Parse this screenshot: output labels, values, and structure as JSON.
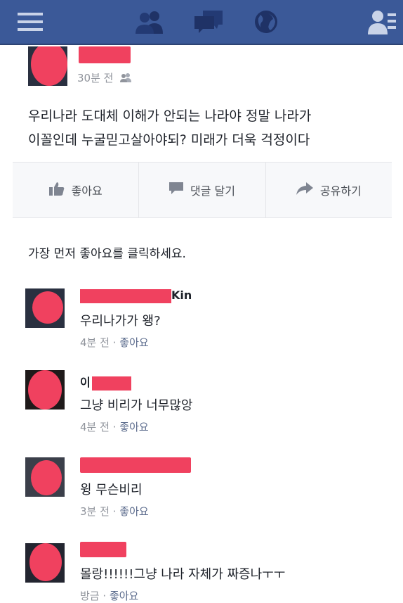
{
  "nav": {
    "icons": [
      "menu-icon",
      "friends-icon",
      "messages-icon",
      "globe-icon",
      "profile-list-icon"
    ]
  },
  "post": {
    "time": "30분 전",
    "audience_icon": "friends-icon",
    "text_line1": "우리나라 도대체 이해가 안되는 나라야 정말 나라가",
    "text_line2": "이꼴인데 누굴믿고살아야되?  미래가 더욱 걱정이다"
  },
  "actions": {
    "like": "좋아요",
    "comment": "댓글 달기",
    "share": "공유하기"
  },
  "first_like_prompt": "가장 먼저 좋아요를 클릭하세요.",
  "comments": [
    {
      "name_visible": "Kin",
      "text": "우리나가가 왱?",
      "time": "4분 전",
      "sep": "·",
      "like": "좋아요"
    },
    {
      "name_visible": "이",
      "text": "그냥 비리가 너무많앙",
      "time": "4분 전",
      "sep": "·",
      "like": "좋아요"
    },
    {
      "name_visible": "",
      "text": "윙 무슨비리",
      "time": "3분 전",
      "sep": "·",
      "like": "좋아요"
    },
    {
      "name_visible": "",
      "text": "몰랑!!!!!!그냥 나라 자체가 짜증나ㅜㅜ",
      "time": "방금",
      "sep": "·",
      "like": "좋아요"
    }
  ],
  "colors": {
    "header": "#3b5998",
    "redaction": "#f0415f",
    "meta_gray": "#90949c"
  }
}
